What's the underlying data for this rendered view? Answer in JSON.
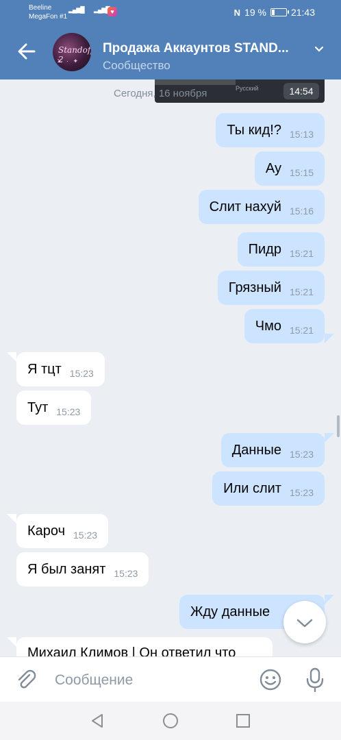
{
  "status_bar": {
    "carrier_1": "Beeline",
    "carrier_2": "MegaFon #1",
    "net_1": "4G",
    "battery": "19 %",
    "battery_level": 0.19,
    "time": "21:43"
  },
  "header": {
    "title": "Продажа Аккаунтов STAND...",
    "subtitle": "Сообщество",
    "avatar_text": "Standoff 2",
    "back_icon": "arrow-left-icon",
    "chevron_icon": "chevron-down-icon"
  },
  "overlay": {
    "language": "Русский",
    "time": "14:54"
  },
  "date_separator": "Сегодня, 16 ноября",
  "messages": [
    {
      "dir": "out",
      "text": "Ты кид!?",
      "time": "15:13"
    },
    {
      "dir": "out",
      "text": "Ау",
      "time": "15:15"
    },
    {
      "dir": "out",
      "text": "Слит нахуй",
      "time": "15:16"
    },
    {
      "dir": "out",
      "text": "Пидр",
      "time": "15:21"
    },
    {
      "dir": "out",
      "text": "Грязный",
      "time": "15:21"
    },
    {
      "dir": "out",
      "text": "Чмо",
      "time": "15:21"
    },
    {
      "dir": "in",
      "text": "Я тцт",
      "time": "15:23"
    },
    {
      "dir": "in",
      "text": "Тут",
      "time": "15:23"
    },
    {
      "dir": "out",
      "text": "Данные",
      "time": "15:23"
    },
    {
      "dir": "out",
      "text": "Или слит",
      "time": "15:23"
    },
    {
      "dir": "in",
      "text": "Кароч",
      "time": "15:23"
    },
    {
      "dir": "in",
      "text": "Я был занят",
      "time": "15:23"
    },
    {
      "dir": "out",
      "text": "Жду данные",
      "time": ""
    },
    {
      "dir": "in",
      "text": "Михаил Климов | Он ответил что",
      "time": ""
    }
  ],
  "input": {
    "placeholder": "Сообщение",
    "attach_icon": "paperclip-icon",
    "emoji_icon": "smile-icon",
    "mic_icon": "microphone-icon"
  },
  "scroll_button_icon": "chevron-down-icon",
  "nav": {
    "back_icon": "triangle-back-icon",
    "home_icon": "circle-home-icon",
    "recents_icon": "square-recents-icon"
  },
  "colors": {
    "header": "#5181b8",
    "background": "#ebeff4",
    "outgoing_bubble": "#cce4ff",
    "incoming_bubble": "#ffffff"
  }
}
